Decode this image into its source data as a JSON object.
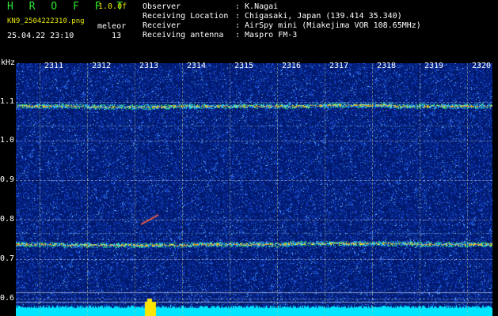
{
  "header": {
    "logo": "H R O F F T",
    "version": "1.0.0f",
    "filename": "KN9_2504222310.png",
    "meteor_label": "meleor",
    "datetime": "25.04.22 23:10",
    "meteor_count": "13",
    "unit": "kHz"
  },
  "info": [
    {
      "label": "Observer",
      "value": ": K.Nagai"
    },
    {
      "label": "Receiving Location",
      "value": ": Chigasaki, Japan (139.414 35.340)"
    },
    {
      "label": "Receiver",
      "value": ": AirSpy mini (Miakejima VOR 108.65MHz)"
    },
    {
      "label": "Receiving antenna",
      "value": ": Maspro FM-3"
    }
  ],
  "x_ticks": [
    "2311",
    "2312",
    "2313",
    "2314",
    "2315",
    "2316",
    "2317",
    "2318",
    "2319",
    "2320"
  ],
  "y_ticks": [
    "1.1",
    "1.0",
    "0.9",
    "0.8",
    "0.7",
    "0.6"
  ],
  "colors": {
    "background": "#001a70",
    "carrier": "#ff9a20",
    "noise": "#3a6cff",
    "echo_bar": "#00e5ff",
    "burst": "#ffe600"
  }
}
